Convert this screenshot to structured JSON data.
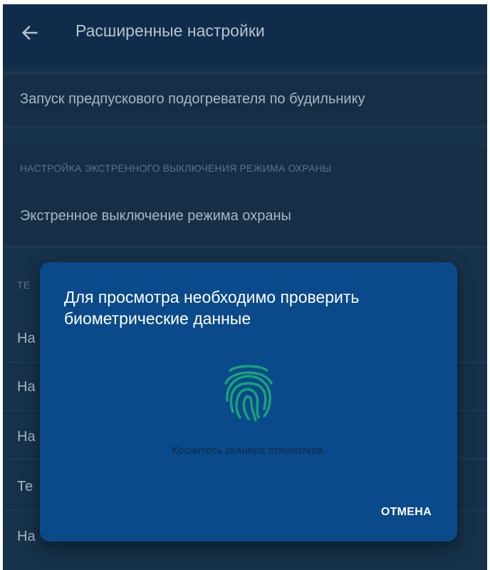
{
  "header": {
    "title": "Расширенные настройки",
    "back_icon": "arrow-left-icon"
  },
  "settings": {
    "preheater_label": "Запуск предпускового подогревателя по будильнику",
    "emergency_section_header": "НАСТРОЙКА ЭКСТРЕННОГО ВЫКЛЮЧЕНИЯ РЕЖИМА ОХРАНЫ",
    "emergency_item_label": "Экстренное выключение режима охраны",
    "partial_section_header": "ТЕ",
    "partial_rows": [
      "На",
      "На",
      "На",
      "Те",
      "На"
    ]
  },
  "dialog": {
    "title": "Для просмотра необходимо проверить биометрические данные",
    "fingerprint_icon": "fingerprint-icon",
    "hint": "Коснитесь сканера отпечатков.",
    "cancel_label": "ОТМЕНА"
  },
  "colors": {
    "dialog_bg": "#0a4a8a",
    "fingerprint": "#1aa27a",
    "app_bg": "#16324a"
  }
}
